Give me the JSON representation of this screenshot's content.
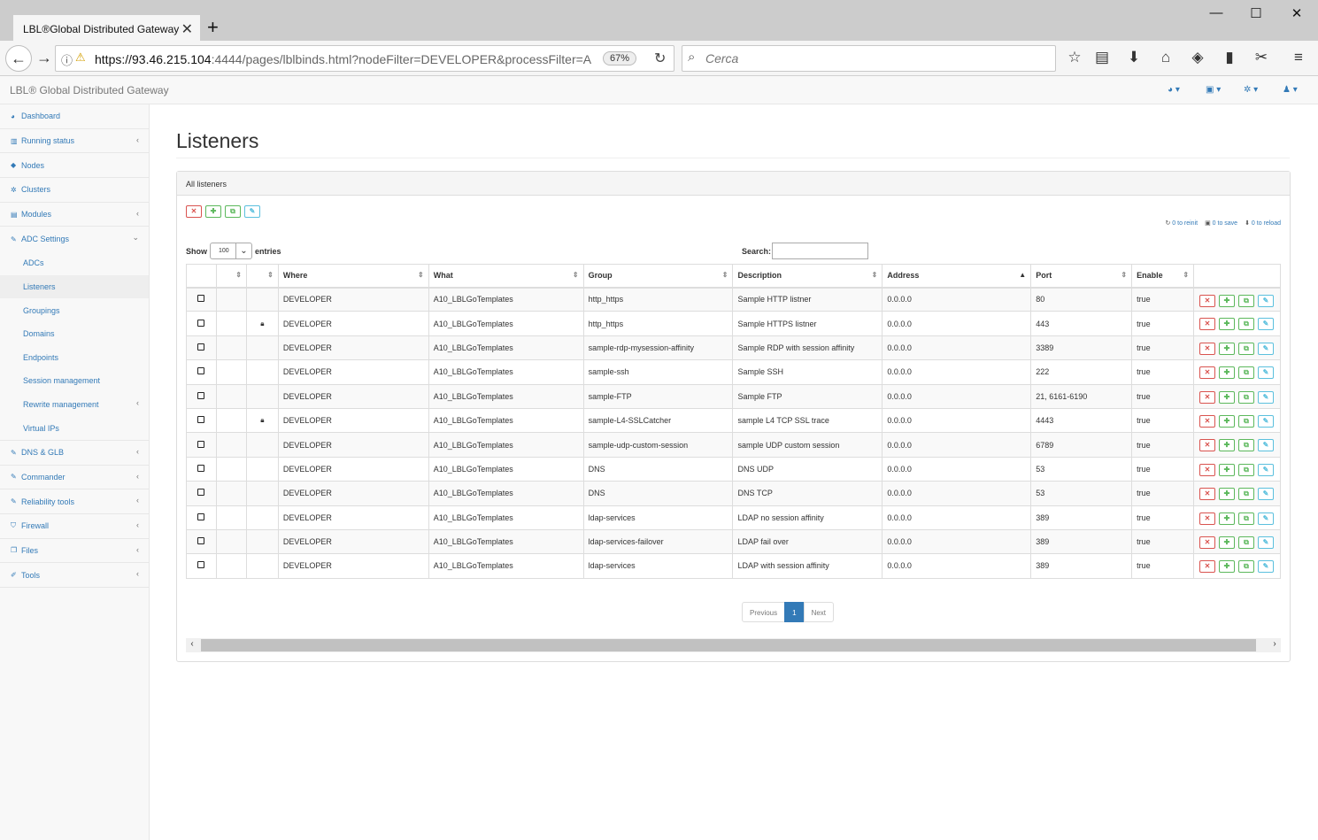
{
  "browser": {
    "tab_title": "LBL®Global Distributed Gateway",
    "url_host": "https://93.46.215.104",
    "url_rest": ":4444/pages/lblbinds.html?nodeFilter=DEVELOPER&processFilter=A",
    "zoom": "67%",
    "search_placeholder": "Cerca"
  },
  "app": {
    "brand": "LBL® Global Distributed Gateway"
  },
  "sidebar": {
    "items": [
      {
        "label": "Dashboard",
        "icon": "dashboard-icon"
      },
      {
        "label": "Running status",
        "icon": "bar-chart-icon"
      },
      {
        "label": "Nodes",
        "icon": "cube-icon"
      },
      {
        "label": "Clusters",
        "icon": "cogs-icon"
      },
      {
        "label": "Modules",
        "icon": "list-icon"
      },
      {
        "label": "ADC Settings",
        "icon": "edit-icon"
      }
    ],
    "adc_sub": [
      {
        "label": "ADCs"
      },
      {
        "label": "Listeners"
      },
      {
        "label": "Groupings"
      },
      {
        "label": "Domains"
      },
      {
        "label": "Endpoints"
      },
      {
        "label": "Session management"
      },
      {
        "label": "Rewrite management"
      },
      {
        "label": "Virtual IPs"
      }
    ],
    "bottom": [
      {
        "label": "DNS & GLB",
        "icon": "edit-icon"
      },
      {
        "label": "Commander",
        "icon": "edit-icon"
      },
      {
        "label": "Reliability tools",
        "icon": "edit-icon"
      },
      {
        "label": "Firewall",
        "icon": "shield-icon"
      },
      {
        "label": "Files",
        "icon": "files-icon"
      },
      {
        "label": "Tools",
        "icon": "wrench-icon"
      }
    ]
  },
  "page": {
    "title": "Listeners",
    "panel_title": "All listeners",
    "status": {
      "reinit": "0 to reinit",
      "save": "0 to save",
      "reload": "0 to reload"
    },
    "show_label": "Show",
    "page_size": "100",
    "entries_label": "entries",
    "search_label": "Search:"
  },
  "table": {
    "headers": [
      "",
      "",
      "",
      "Where",
      "What",
      "Group",
      "Description",
      "Address",
      "Port",
      "Enable",
      ""
    ],
    "rows": [
      {
        "locked": false,
        "where": "DEVELOPER",
        "what": "A10_LBLGoTemplates",
        "group": "http_https",
        "description": "Sample HTTP listner",
        "address": "0.0.0.0",
        "port": "80",
        "enable": "true"
      },
      {
        "locked": true,
        "where": "DEVELOPER",
        "what": "A10_LBLGoTemplates",
        "group": "http_https",
        "description": "Sample HTTPS listner",
        "address": "0.0.0.0",
        "port": "443",
        "enable": "true"
      },
      {
        "locked": false,
        "where": "DEVELOPER",
        "what": "A10_LBLGoTemplates",
        "group": "sample-rdp-mysession-affinity",
        "description": "Sample RDP with session affinity",
        "address": "0.0.0.0",
        "port": "3389",
        "enable": "true"
      },
      {
        "locked": false,
        "where": "DEVELOPER",
        "what": "A10_LBLGoTemplates",
        "group": "sample-ssh",
        "description": "Sample SSH",
        "address": "0.0.0.0",
        "port": "222",
        "enable": "true"
      },
      {
        "locked": false,
        "where": "DEVELOPER",
        "what": "A10_LBLGoTemplates",
        "group": "sample-FTP",
        "description": "Sample FTP",
        "address": "0.0.0.0",
        "port": "21, 6161-6190",
        "enable": "true"
      },
      {
        "locked": true,
        "where": "DEVELOPER",
        "what": "A10_LBLGoTemplates",
        "group": "sample-L4-SSLCatcher",
        "description": "sample L4 TCP SSL trace",
        "address": "0.0.0.0",
        "port": "4443",
        "enable": "true"
      },
      {
        "locked": false,
        "where": "DEVELOPER",
        "what": "A10_LBLGoTemplates",
        "group": "sample-udp-custom-session",
        "description": "sample UDP custom session",
        "address": "0.0.0.0",
        "port": "6789",
        "enable": "true"
      },
      {
        "locked": false,
        "where": "DEVELOPER",
        "what": "A10_LBLGoTemplates",
        "group": "DNS",
        "description": "DNS UDP",
        "address": "0.0.0.0",
        "port": "53",
        "enable": "true"
      },
      {
        "locked": false,
        "where": "DEVELOPER",
        "what": "A10_LBLGoTemplates",
        "group": "DNS",
        "description": "DNS TCP",
        "address": "0.0.0.0",
        "port": "53",
        "enable": "true"
      },
      {
        "locked": false,
        "where": "DEVELOPER",
        "what": "A10_LBLGoTemplates",
        "group": "ldap-services",
        "description": "LDAP no session affinity",
        "address": "0.0.0.0",
        "port": "389",
        "enable": "true"
      },
      {
        "locked": false,
        "where": "DEVELOPER",
        "what": "A10_LBLGoTemplates",
        "group": "ldap-services-failover",
        "description": "LDAP fail over",
        "address": "0.0.0.0",
        "port": "389",
        "enable": "true"
      },
      {
        "locked": false,
        "where": "DEVELOPER",
        "what": "A10_LBLGoTemplates",
        "group": "ldap-services",
        "description": "LDAP with session affinity",
        "address": "0.0.0.0",
        "port": "389",
        "enable": "true"
      }
    ]
  },
  "pagination": {
    "previous": "Previous",
    "current": "1",
    "next": "Next"
  },
  "colors": {
    "link": "#337ab7",
    "danger": "#d9534f",
    "success": "#5cb85c",
    "info": "#5bc0de"
  }
}
